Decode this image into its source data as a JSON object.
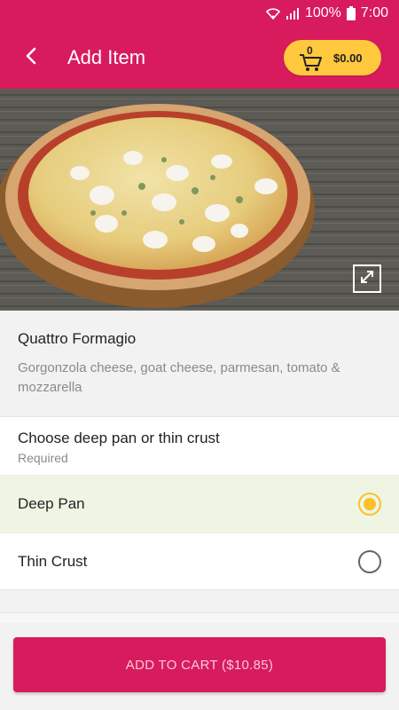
{
  "status_bar": {
    "battery": "100%",
    "time": "7:00"
  },
  "app_bar": {
    "title": "Add Item",
    "cart_count": "0",
    "cart_total": "$0.00"
  },
  "item": {
    "name": "Quattro Formagio",
    "description": "Gorgonzola cheese, goat cheese, parmesan, tomato & mozzarella"
  },
  "option_group": {
    "title": "Choose deep pan or thin crust",
    "subtitle": "Required",
    "options": [
      {
        "label": "Deep Pan",
        "selected": true
      },
      {
        "label": "Thin Crust",
        "selected": false
      }
    ]
  },
  "add_to_cart": {
    "label": "ADD TO CART",
    "price": "($10.85)"
  },
  "colors": {
    "primary": "#d81b5d",
    "accent": "#ffc83d",
    "selected_row": "#eef6e3"
  }
}
